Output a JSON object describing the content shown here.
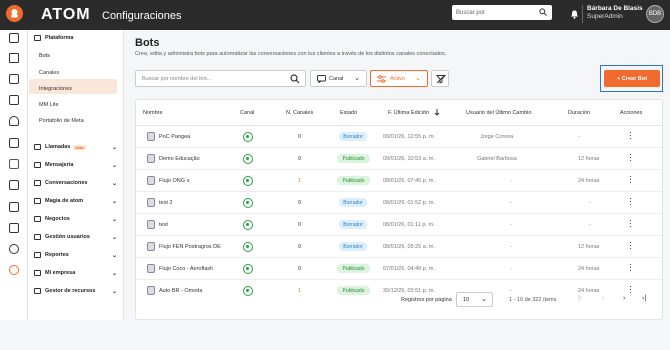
{
  "app": {
    "logo_text": "ATOM",
    "section_title": "Configuraciones"
  },
  "header": {
    "search_placeholder": "Buscar por",
    "user_name": "Bárbara De Blasis",
    "user_role": "SuperAdmin",
    "avatar_initials": "BDB"
  },
  "sidebar": {
    "platform": "Plataforma",
    "platform_items": [
      "Bots",
      "Canales",
      "Integraciones",
      "MM Lite",
      "Portafolio de Meta"
    ],
    "sections": [
      {
        "label": "Llamadas",
        "badge": "beta"
      },
      {
        "label": "Mensajería"
      },
      {
        "label": "Conversaciones"
      },
      {
        "label": "Magia de atom"
      },
      {
        "label": "Negocios"
      },
      {
        "label": "Gestión usuarios"
      },
      {
        "label": "Reportes"
      },
      {
        "label": "Mi empresa"
      },
      {
        "label": "Gestor de recursos"
      }
    ]
  },
  "page": {
    "title": "Bots",
    "subtitle": "Crea, edita y administra bots para automatizar las conversaciones con tus clientes a través de los distintos canales conectados."
  },
  "filters": {
    "search_placeholder": "Buscar por nombre del bot...",
    "canal_label": "Canal",
    "estado_label": "Activo",
    "create_button": "+ Crear Bot"
  },
  "table": {
    "headers": [
      "Nombre",
      "Canal",
      "N. Canales",
      "Estado",
      "F. Última Edición",
      "Usuario del Último Cambio",
      "Duración",
      "Acciones"
    ],
    "rows": [
      {
        "name": "PoC Pangea",
        "canales": "0",
        "estado": "Borrador",
        "fecha": "09/01/26, 12:55 p. m.",
        "usuario": "Jorge Corona",
        "duracion": "-"
      },
      {
        "name": "Demo Educação",
        "canales": "0",
        "estado": "Publicado",
        "fecha": "09/01/26, 10:53 a. m.",
        "usuario": "Gabriel Barbosa",
        "duracion": "12 horas"
      },
      {
        "name": "Flujo ONG´s",
        "canales": "1",
        "estado": "Publicado",
        "fecha": "08/01/26, 07:45 p. m.",
        "usuario": "-",
        "duracion": "24 horas"
      },
      {
        "name": "test 2",
        "canales": "0",
        "estado": "Borrador",
        "fecha": "08/01/26, 01:52 p. m.",
        "usuario": "-",
        "duracion": "-"
      },
      {
        "name": "test",
        "canales": "0",
        "estado": "Borrador",
        "fecha": "08/01/26, 01:11 p. m.",
        "usuario": "-",
        "duracion": "-"
      },
      {
        "name": "Flujo FEN Postragros DE",
        "canales": "0",
        "estado": "Borrador",
        "fecha": "08/01/26, 09:25 a. m.",
        "usuario": "-",
        "duracion": "12 horas"
      },
      {
        "name": "Flujo Coco - Aeroflash",
        "canales": "0",
        "estado": "Publicado",
        "fecha": "07/01/26, 04:49 p. m.",
        "usuario": "-",
        "duracion": "24 horas"
      },
      {
        "name": "Auto BR - Omoda",
        "canales": "1",
        "estado": "Publicado",
        "fecha": "30/12/25, 03:51 p. m.",
        "usuario": "-",
        "duracion": "24 horas"
      }
    ]
  },
  "pagination": {
    "rows_label": "Registros por página",
    "rows_value": "10",
    "range": "1 - 10 de 322 ítems"
  },
  "colors": {
    "accent": "#f26b2e",
    "topbar": "#2b2b2b",
    "borrador": "#2f83c8",
    "publicado": "#2a8b3a"
  }
}
